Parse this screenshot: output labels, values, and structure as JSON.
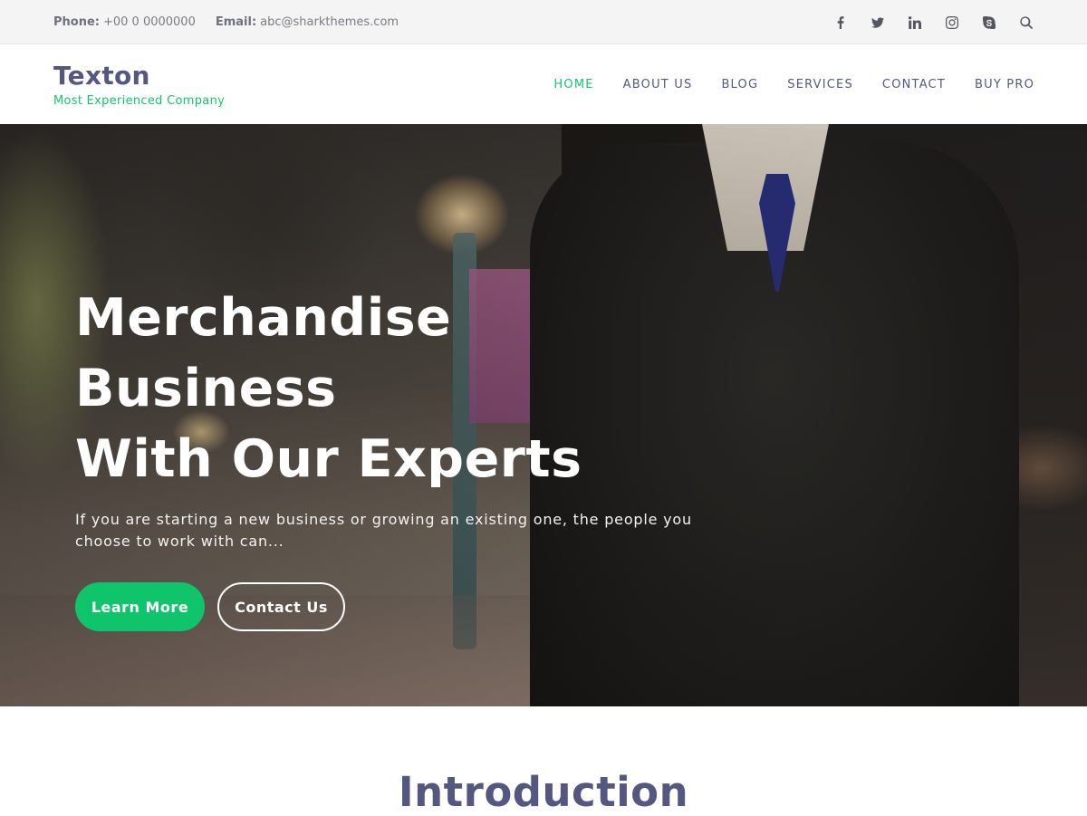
{
  "topbar": {
    "phone_label": "Phone:",
    "phone_value": "+00 0 0000000",
    "email_label": "Email:",
    "email_value": "abc@sharkthemes.com",
    "social_icons": [
      "facebook-icon",
      "twitter-icon",
      "linkedin-icon",
      "instagram-icon",
      "skype-icon",
      "search-icon"
    ]
  },
  "header": {
    "site_name": "Texton",
    "tagline": "Most Experienced Company",
    "nav": [
      {
        "label": "HOME",
        "active": true
      },
      {
        "label": "ABOUT US"
      },
      {
        "label": "BLOG"
      },
      {
        "label": "SERVICES"
      },
      {
        "label": "CONTACT"
      },
      {
        "label": "BUY PRO"
      }
    ]
  },
  "hero": {
    "title_line1": "Merchandise Business",
    "title_line2": "With Our Experts",
    "subtitle": "If you are starting a new business or growing an existing one, the people you choose to work with can...",
    "primary_button": "Learn More",
    "secondary_button": "Contact Us"
  },
  "intro": {
    "title": "Introduction"
  },
  "colors": {
    "accent": "#14c46e",
    "heading": "#545880",
    "topbar_bg": "#f4f4f5"
  }
}
